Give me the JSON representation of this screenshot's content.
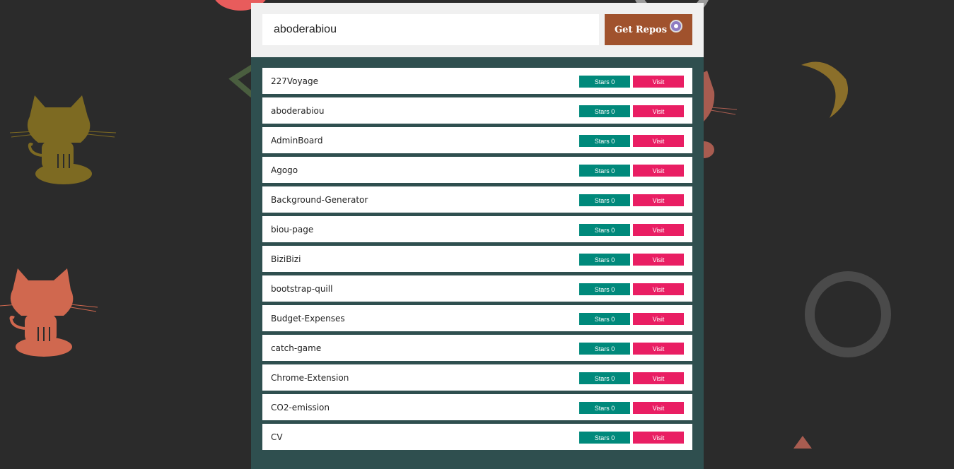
{
  "search": {
    "value": "aboderabiou"
  },
  "toolbar": {
    "get_repos_label": "Get Repos"
  },
  "repos": [
    {
      "name": "227Voyage",
      "stars": "Stars 0",
      "visit": "Visit"
    },
    {
      "name": "aboderabiou",
      "stars": "Stars 0",
      "visit": "Visit"
    },
    {
      "name": "AdminBoard",
      "stars": "Stars 0",
      "visit": "Visit"
    },
    {
      "name": "Agogo",
      "stars": "Stars 0",
      "visit": "Visit"
    },
    {
      "name": "Background-Generator",
      "stars": "Stars 0",
      "visit": "Visit"
    },
    {
      "name": "biou-page",
      "stars": "Stars 0",
      "visit": "Visit"
    },
    {
      "name": "BiziBizi",
      "stars": "Stars 0",
      "visit": "Visit"
    },
    {
      "name": "bootstrap-quill",
      "stars": "Stars 0",
      "visit": "Visit"
    },
    {
      "name": "Budget-Expenses",
      "stars": "Stars 0",
      "visit": "Visit"
    },
    {
      "name": "catch-game",
      "stars": "Stars 0",
      "visit": "Visit"
    },
    {
      "name": "Chrome-Extension",
      "stars": "Stars 0",
      "visit": "Visit"
    },
    {
      "name": "CO2-emission",
      "stars": "Stars 0",
      "visit": "Visit"
    },
    {
      "name": "CV",
      "stars": "Stars 0",
      "visit": "Visit"
    }
  ],
  "colors": {
    "background": "#2b2b2b",
    "panel": "#2f4f4f",
    "get_repos_button": "#a0522d",
    "stars_button": "#00897b",
    "visit_button": "#e91e63"
  },
  "icons": {
    "get_repos_button_icon": "github-icon",
    "decorations": [
      "octocat-icon",
      "octocat-icon",
      "circle-icon",
      "banana-icon",
      "square-outline-icon"
    ]
  }
}
